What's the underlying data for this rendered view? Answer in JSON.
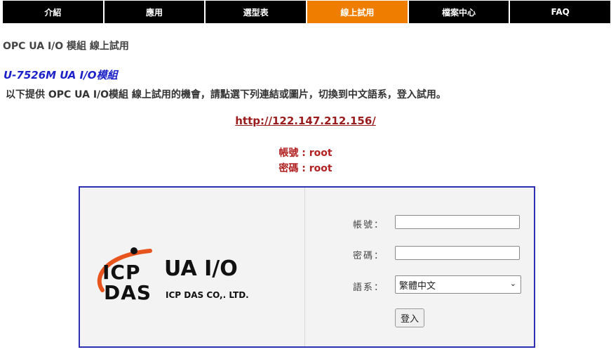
{
  "nav": {
    "tabs": [
      {
        "label": "介紹"
      },
      {
        "label": "應用"
      },
      {
        "label": "選型表"
      },
      {
        "label": "線上試用"
      },
      {
        "label": "檔案中心"
      },
      {
        "label": "FAQ"
      }
    ],
    "active_index": 3
  },
  "breadcrumb": "OPC UA I/O 模組 線上試用",
  "product_title": "U-7526M UA I/O模組",
  "intro": "以下提供 OPC UA I/O模組 線上試用的機會，請點選下列連結或圖片，切換到中文語系，登入試用。",
  "demo_link": "http://122.147.212.156/",
  "credentials": {
    "account": "帳號 : root",
    "password": "密碼 : root"
  },
  "login": {
    "logo": {
      "icp": "ICP",
      "das": "DAS",
      "product": "UA I/O",
      "company": "ICP DAS CO,. LTD."
    },
    "account_label": "帳號：",
    "password_label": "密碼：",
    "language_label": "語系：",
    "language_value": "繁體中文",
    "submit_label": "登入"
  },
  "colors": {
    "nav_bg": "#000000",
    "nav_active": "#ef7d00",
    "product_title": "#1c22c8",
    "link": "#9b1c1c",
    "credentials": "#b22222",
    "login_border": "#2f2fb6",
    "logo_arc": "#e8541e"
  }
}
